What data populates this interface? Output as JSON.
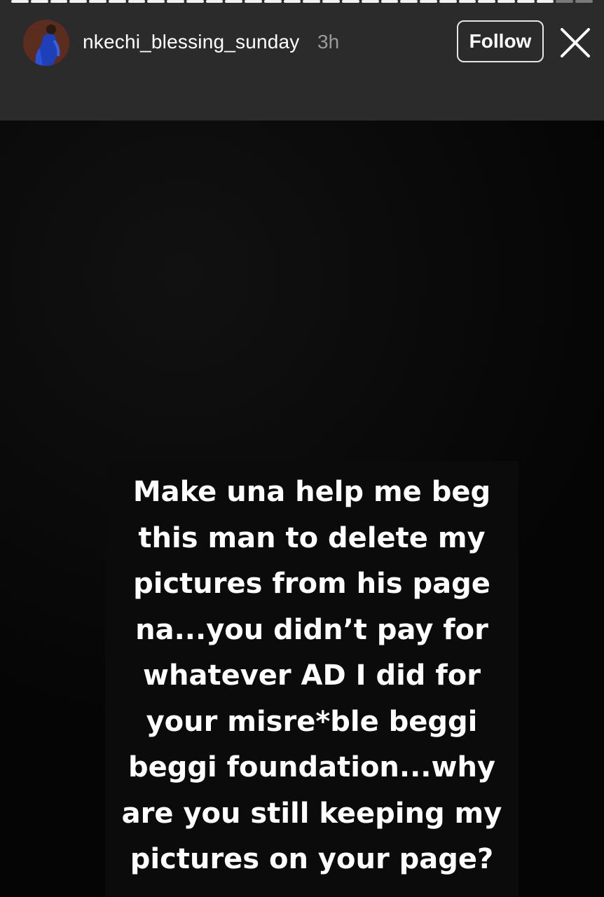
{
  "header": {
    "username": "nkechi_blessing_sunday",
    "timestamp": "3h",
    "follow_label": "Follow",
    "close_icon": "close-icon",
    "avatar_icon": "profile-avatar"
  },
  "progress": {
    "total_segments": 30,
    "current_segment": 28
  },
  "story": {
    "lines": [
      "Make una help me beg",
      "this man to delete my",
      "pictures from his page",
      "na...you didn’t pay for",
      "whatever AD I did for",
      "your misre*ble beggi",
      "beggi foundation...why",
      "are you still keeping my",
      "pictures on your page?"
    ]
  },
  "colors": {
    "header_bg": "#2b2b2b",
    "story_bg": "#050505",
    "text": "#ffffff",
    "timestamp": "#9a9a9a"
  }
}
